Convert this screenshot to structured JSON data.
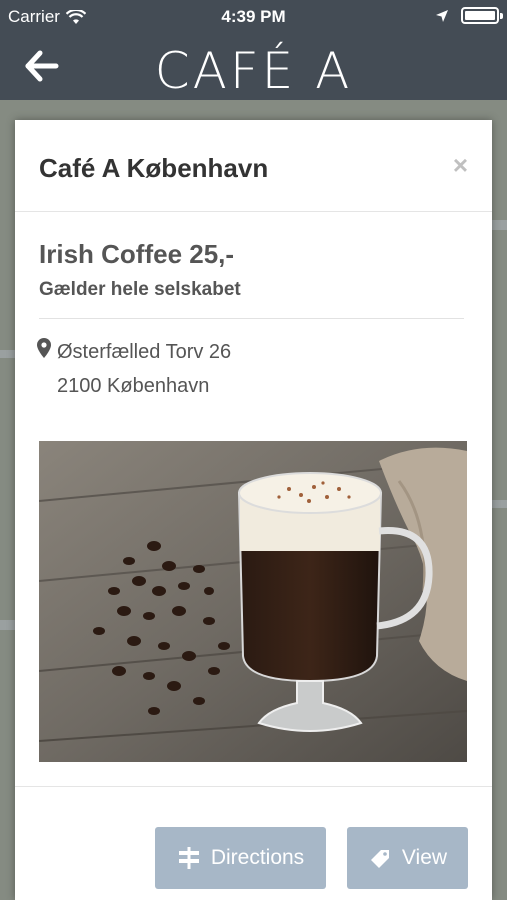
{
  "statusbar": {
    "carrier": "Carrier",
    "time": "4:39 PM"
  },
  "navbar": {
    "brand": "CAFÉ A",
    "back_icon": "arrow-left-icon"
  },
  "modal": {
    "title": "Café A København",
    "close_label": "×",
    "offer_title": "Irish Coffee 25,-",
    "offer_subtitle": "Gælder hele selskabet",
    "address_line1": "Østerfælled Torv 26",
    "address_line2": "2100 København",
    "buttons": {
      "directions": "Directions",
      "view": "View"
    }
  },
  "colors": {
    "header_bg": "#444c55",
    "button_bg": "#a7b7c7",
    "text": "#555555"
  },
  "icons": {
    "location": "map-pin-icon",
    "directions": "signpost-icon",
    "view": "tag-icon"
  }
}
